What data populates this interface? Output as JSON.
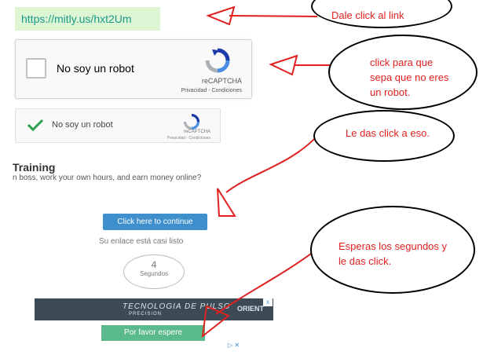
{
  "link": {
    "text": "https://mitly.us/hxt2Um"
  },
  "recaptcha": {
    "label": "No soy un robot",
    "brand": "reCAPTCHA",
    "terms": "Privacidad - Condiciones"
  },
  "recaptcha_checked": {
    "label": "No soy un robot",
    "brand": "reCAPTCHA",
    "terms": "Privacidad - Condiciones"
  },
  "page": {
    "title": "Training",
    "subtitle": "n boss, work your own hours, and earn money online?",
    "continue_button": "Click here to continue",
    "ready_text": "Su enlace está casi listo",
    "countdown": {
      "value": "4",
      "label": "Segundos"
    },
    "wait_button": "Por favor espere"
  },
  "ad": {
    "headline": "TECNOLOGIA DE PULSO",
    "sub": "PRECISION",
    "brand": "ORIENT",
    "close": "x",
    "choices": "▷ ✕"
  },
  "annotations": {
    "note1": "Dale click al link",
    "note2": "click para que sepa que no eres un robot.",
    "note3": "Le das click a eso.",
    "note4": "Esperas los segundos y le das click."
  },
  "colors": {
    "annotation": "#e02020",
    "button_blue": "#3f8fcd",
    "button_green": "#5bba8c",
    "link_bg": "#ddf5d3"
  }
}
